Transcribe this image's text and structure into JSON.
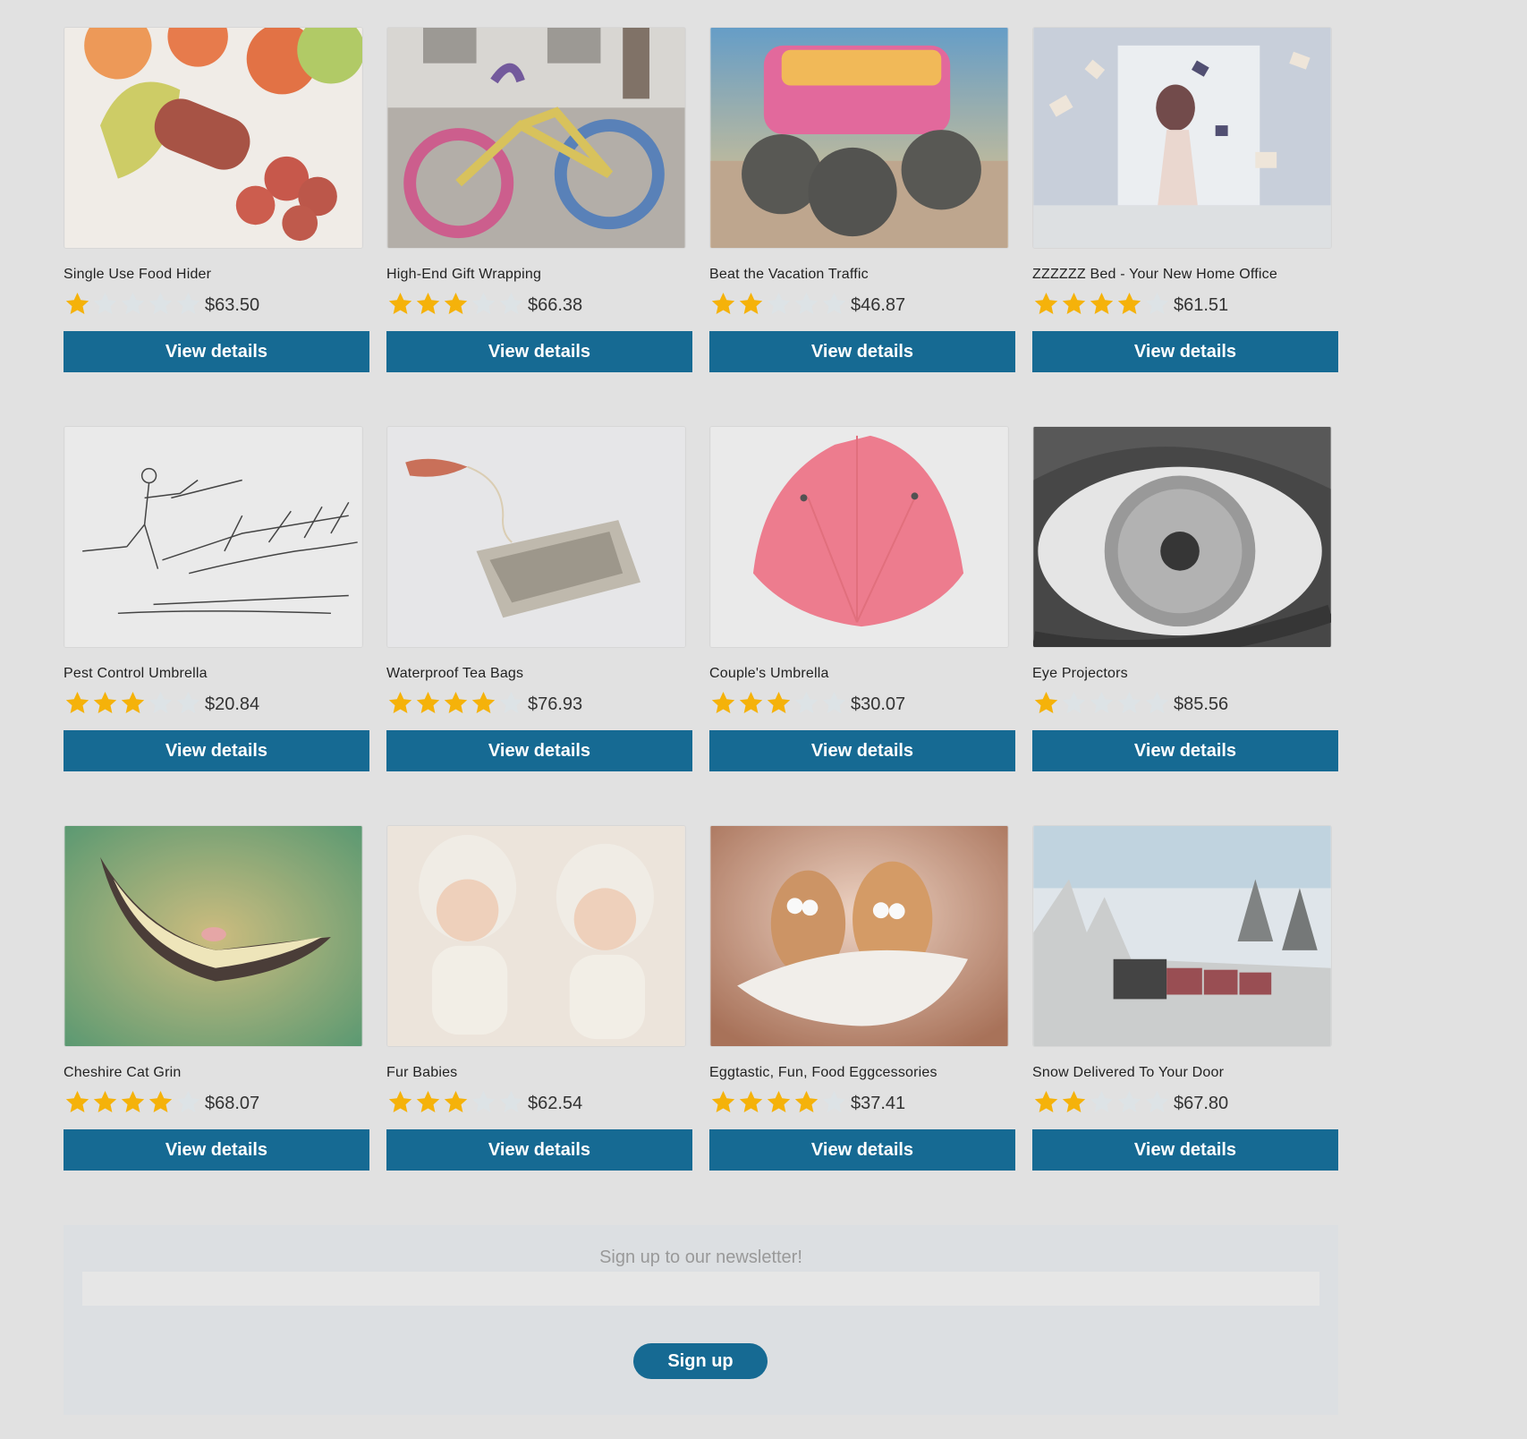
{
  "colors": {
    "button": "#166a93",
    "star_filled": "#f5b20a",
    "star_empty": "#dde3e6",
    "background": "#e1e1e1"
  },
  "products": [
    {
      "title": "Single Use Food Hider",
      "price": "$63.50",
      "rating": 1,
      "image": "food-hider-image",
      "button": "View details"
    },
    {
      "title": "High-End Gift Wrapping",
      "price": "$66.38",
      "rating": 3,
      "image": "yarn-bike-image",
      "button": "View details"
    },
    {
      "title": "Beat the Vacation Traffic",
      "price": "$46.87",
      "rating": 2,
      "image": "monster-van-image",
      "button": "View details"
    },
    {
      "title": "ZZZZZZ Bed - Your New Home Office",
      "price": "$61.51",
      "rating": 4,
      "image": "flying-books-image",
      "button": "View details"
    },
    {
      "title": "Pest Control Umbrella",
      "price": "$20.84",
      "rating": 3,
      "image": "sketch-umbrella-image",
      "button": "View details"
    },
    {
      "title": "Waterproof Tea Bags",
      "price": "$76.93",
      "rating": 4,
      "image": "tea-bag-image",
      "button": "View details"
    },
    {
      "title": "Couple's Umbrella",
      "price": "$30.07",
      "rating": 3,
      "image": "pink-umbrella-image",
      "button": "View details"
    },
    {
      "title": "Eye Projectors",
      "price": "$85.56",
      "rating": 1,
      "image": "eye-image",
      "button": "View details"
    },
    {
      "title": "Cheshire Cat Grin",
      "price": "$68.07",
      "rating": 4,
      "image": "cat-grin-image",
      "button": "View details"
    },
    {
      "title": "Fur Babies",
      "price": "$62.54",
      "rating": 3,
      "image": "babies-image",
      "button": "View details"
    },
    {
      "title": "Eggtastic, Fun, Food Eggcessories",
      "price": "$37.41",
      "rating": 4,
      "image": "eggs-image",
      "button": "View details"
    },
    {
      "title": "Snow Delivered To Your Door",
      "price": "$67.80",
      "rating": 2,
      "image": "snow-train-image",
      "button": "View details"
    }
  ],
  "newsletter": {
    "title": "Sign up to our newsletter!",
    "input_value": "",
    "button": "Sign up"
  }
}
